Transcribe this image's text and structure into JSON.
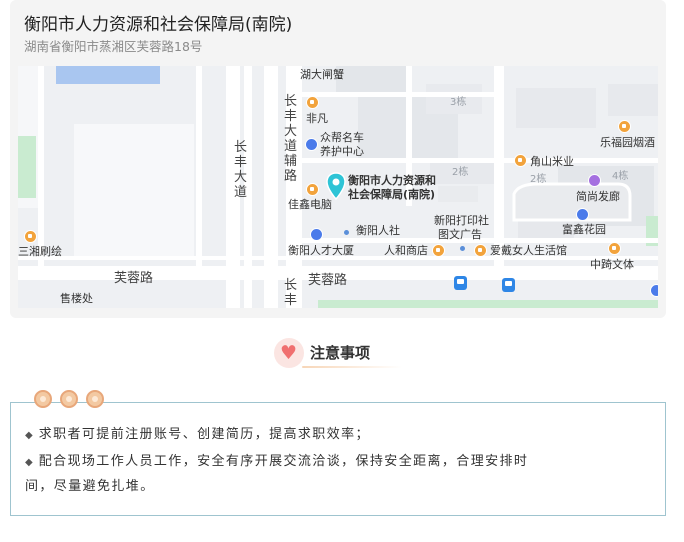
{
  "location": {
    "title": "衡阳市人力资源和社会保障局(南院)",
    "address": "湖南省衡阳市蒸湘区芙蓉路18号",
    "map": {
      "pin_label": "衡阳市人力资源和\n社会保障局(南院)",
      "pin_label_line1": "衡阳市人力资源和",
      "pin_label_line2": "社会保障局(南院)",
      "pois": {
        "hudazhaxie": "湖大闸蟹",
        "feifan": "非凡",
        "zhongbang": "众帮名车",
        "zhongbang2": "养护中心",
        "jiaxin": "佳鑫电脑",
        "hengyangrenshe": "衡阳人社",
        "renlidasha": "衡阳人才大厦",
        "renhe": "人和商店",
        "xinyang": "新阳打印社",
        "xinyang2": "图文广告",
        "aidai": "爱戴女人生活馆",
        "jiaoshan": "角山米业",
        "lefuyuan": "乐福园烟酒",
        "jianjian": "简尚发廊",
        "fuxin": "富鑫花园",
        "zhongqi": "中踦文体",
        "sanxiang": "三湘刷绘",
        "shoulou": "售楼处"
      },
      "buildings": {
        "b3": "3栋",
        "b2a": "2栋",
        "b2b": "2栋",
        "b4": "4栋"
      },
      "roads": {
        "furong_left": "芙蓉路",
        "furong_right": "芙蓉路",
        "changfeng_main": "长丰大道",
        "changfeng_aux": "长丰大道辅路",
        "changfeng_bottom": "长丰"
      }
    }
  },
  "section": {
    "title": "注意事项",
    "icon": "heart-icon"
  },
  "notice": {
    "items": [
      "求职者可提前注册账号、创建简历，提高求职效率；",
      "配合现场工作人员工作，安全有序开展交流洽谈，保持安全距离，合理安排时"
    ],
    "item2_cont": "间，尽量避免扎堆。",
    "bullet": "◆"
  },
  "colors": {
    "accent": "#f06f6f",
    "border": "#9fc4cf",
    "pin": "#2ec4d6",
    "poi": "#f2a33c"
  }
}
